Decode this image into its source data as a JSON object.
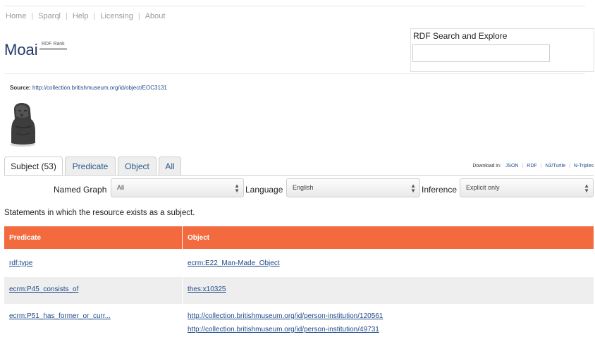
{
  "nav": {
    "items": [
      "Home",
      "Sparql",
      "Help",
      "Licensing",
      "About"
    ]
  },
  "page": {
    "title": "Moai",
    "rank_badge": "RDF Rank"
  },
  "search": {
    "label": "RDF Search and Explore",
    "placeholder": ""
  },
  "source": {
    "label": "Source:",
    "url": "http://collection.britishmuseum.org/id/object/EOC3131"
  },
  "tabs": [
    {
      "label": "Subject (53)",
      "active": true
    },
    {
      "label": "Predicate",
      "active": false
    },
    {
      "label": "Object",
      "active": false
    },
    {
      "label": "All",
      "active": false
    }
  ],
  "downloads": {
    "label": "Download in:",
    "formats": [
      "JSON",
      "RDF",
      "N3/Turtle",
      "N-Triples"
    ]
  },
  "filters": {
    "named_graph": {
      "label": "Named Graph",
      "value": "All"
    },
    "language": {
      "label": "Language",
      "value": "English"
    },
    "inference": {
      "label": "Inference",
      "value": "Explicit only"
    }
  },
  "intro": "Statements in which the resource exists as a subject.",
  "table": {
    "headers": [
      "Predicate",
      "Object"
    ],
    "rows": [
      {
        "predicate": "rdf:type",
        "objects": [
          "ecrm:E22_Man-Made_Object"
        ]
      },
      {
        "predicate": "ecrm:P45_consists_of",
        "objects": [
          "thes:x10325"
        ]
      },
      {
        "predicate": "ecrm:P51_has_former_or_curr...",
        "objects": [
          "http://collection.britishmuseum.org/id/person-institution/120561",
          "http://collection.britishmuseum.org/id/person-institution/49731"
        ]
      }
    ]
  },
  "colors": {
    "table_header": "#f26a3e",
    "link": "#1f4a8a",
    "title": "#1f3a66"
  }
}
